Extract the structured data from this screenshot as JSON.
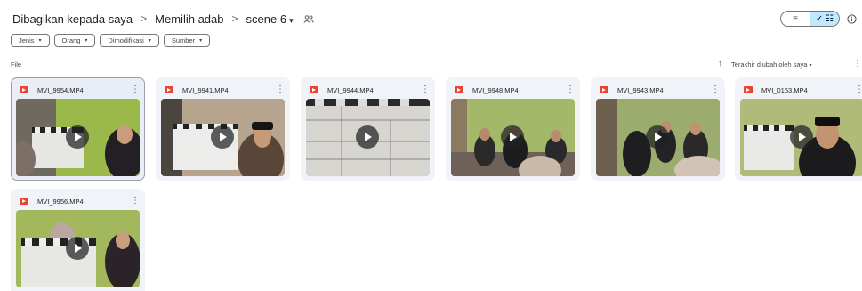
{
  "breadcrumb": {
    "items": [
      "Dibagikan kepada saya",
      "Memilih adab",
      "scene 6"
    ],
    "separator": ">",
    "dropdown_caret": "▾"
  },
  "view_toggle": {
    "list_icon": "≡",
    "grid_check": "✓",
    "grid_icon": "☷"
  },
  "filters": [
    {
      "label": "Jenis",
      "caret": "▾"
    },
    {
      "label": "Orang",
      "caret": "▾"
    },
    {
      "label": "Dimodifikasi",
      "caret": "▾"
    },
    {
      "label": "Sumber",
      "caret": "▾"
    }
  ],
  "section_label": "File",
  "sort": {
    "arrow": "↑",
    "label": "Terakhir diubah oleh saya",
    "caret": "▾",
    "more": "⋮"
  },
  "files": [
    {
      "name": "MVI_9954.MP4",
      "more": "⋮",
      "selected": true
    },
    {
      "name": "MVI_9941.MP4",
      "more": "⋮"
    },
    {
      "name": "MVI_9944.MP4",
      "more": "⋮"
    },
    {
      "name": "MVI_9948.MP4",
      "more": "⋮"
    },
    {
      "name": "MVI_9943.MP4",
      "more": "⋮"
    },
    {
      "name": "MVI_0153.MP4",
      "more": "⋮"
    },
    {
      "name": "MVI_9956.MP4",
      "more": "⋮"
    }
  ],
  "icons": {
    "shared_folder": "people-icon",
    "file_type": "video-file-icon",
    "play": "play-icon",
    "info": "info-icon"
  },
  "colors": {
    "accent": "#c2e7ff",
    "card_bg": "#f0f4f9",
    "video_icon": "#ea4335"
  }
}
